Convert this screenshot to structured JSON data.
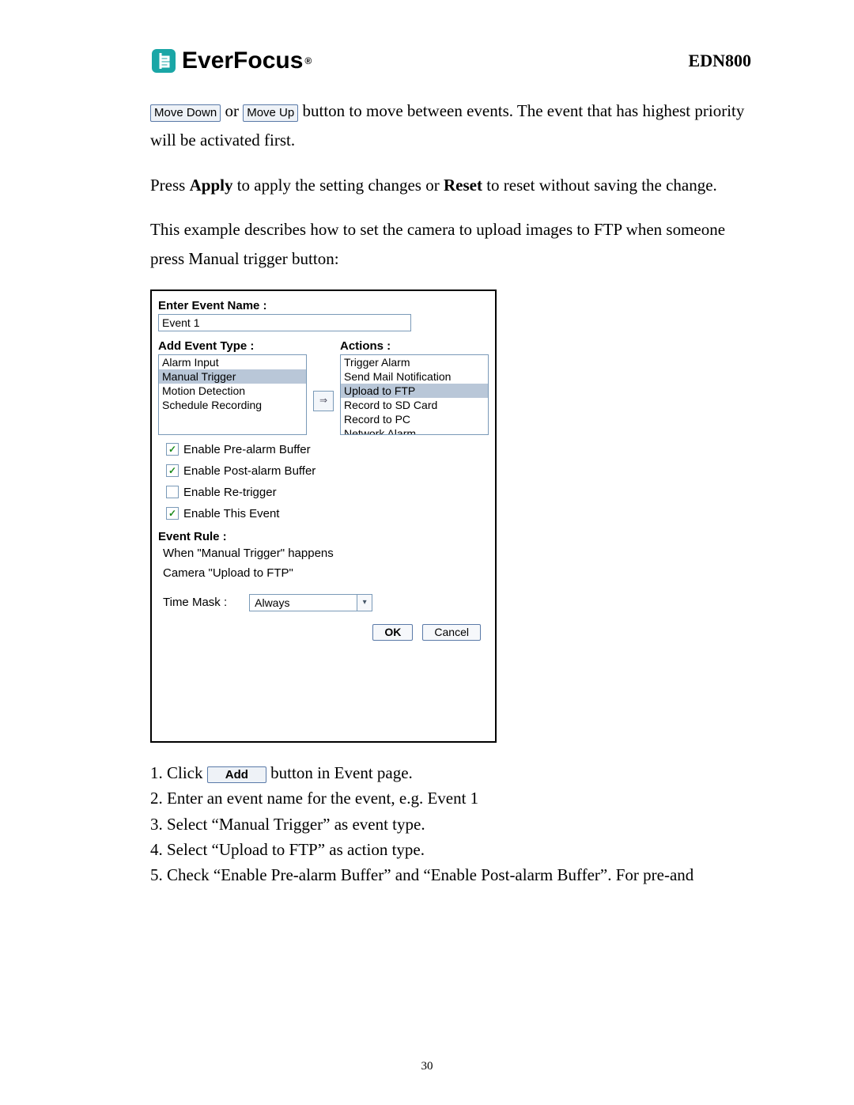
{
  "header": {
    "brand": "EverFocus",
    "model": "EDN800"
  },
  "intro": {
    "btn_move_down": "Move Down",
    "or": " or ",
    "btn_move_up": "Move Up",
    "after_buttons": " button to move between events. The event that has highest priority will be activated first.",
    "apply_reset": "Press Apply to apply the setting changes or Reset to reset without saving the change.",
    "apply_word": "Apply",
    "reset_word": "Reset",
    "example": "This example describes how to set the camera to upload images to FTP when someone press Manual trigger button:"
  },
  "dialog": {
    "enter_event_name": "Enter Event Name :",
    "event_name_value": "Event 1",
    "add_event_type": "Add Event Type :",
    "actions": "Actions :",
    "event_types": [
      "Alarm Input",
      "Manual Trigger",
      "Motion Detection",
      "Schedule Recording"
    ],
    "event_type_selected": "Manual Trigger",
    "actions_list": [
      "Trigger Alarm",
      "Send Mail Notification",
      "Upload to FTP",
      "Record to SD Card",
      "Record to PC",
      "Network Alarm"
    ],
    "action_selected": "Upload to FTP",
    "arrow": "⇒",
    "cb_prealarm": "Enable Pre-alarm Buffer",
    "cb_postalarm": "Enable Post-alarm Buffer",
    "cb_retrigger": "Enable Re-trigger",
    "cb_thisevent": "Enable This Event",
    "event_rule": "Event Rule :",
    "rule1": "When \"Manual Trigger\" happens",
    "rule2": "Camera \"Upload to FTP\"",
    "time_mask": "Time Mask :",
    "time_mask_value": "Always",
    "ok": "OK",
    "cancel": "Cancel"
  },
  "steps": {
    "s1a": "1. Click ",
    "s1_btn": "Add",
    "s1b": " button in Event page.",
    "s2": "2. Enter an event name for the event, e.g. Event 1",
    "s3": "3. Select “Manual Trigger” as event type.",
    "s4": "4. Select “Upload to FTP” as action type.",
    "s5": "5. Check “Enable Pre-alarm Buffer” and “Enable Post-alarm Buffer”. For pre-and"
  },
  "page_number": "30"
}
